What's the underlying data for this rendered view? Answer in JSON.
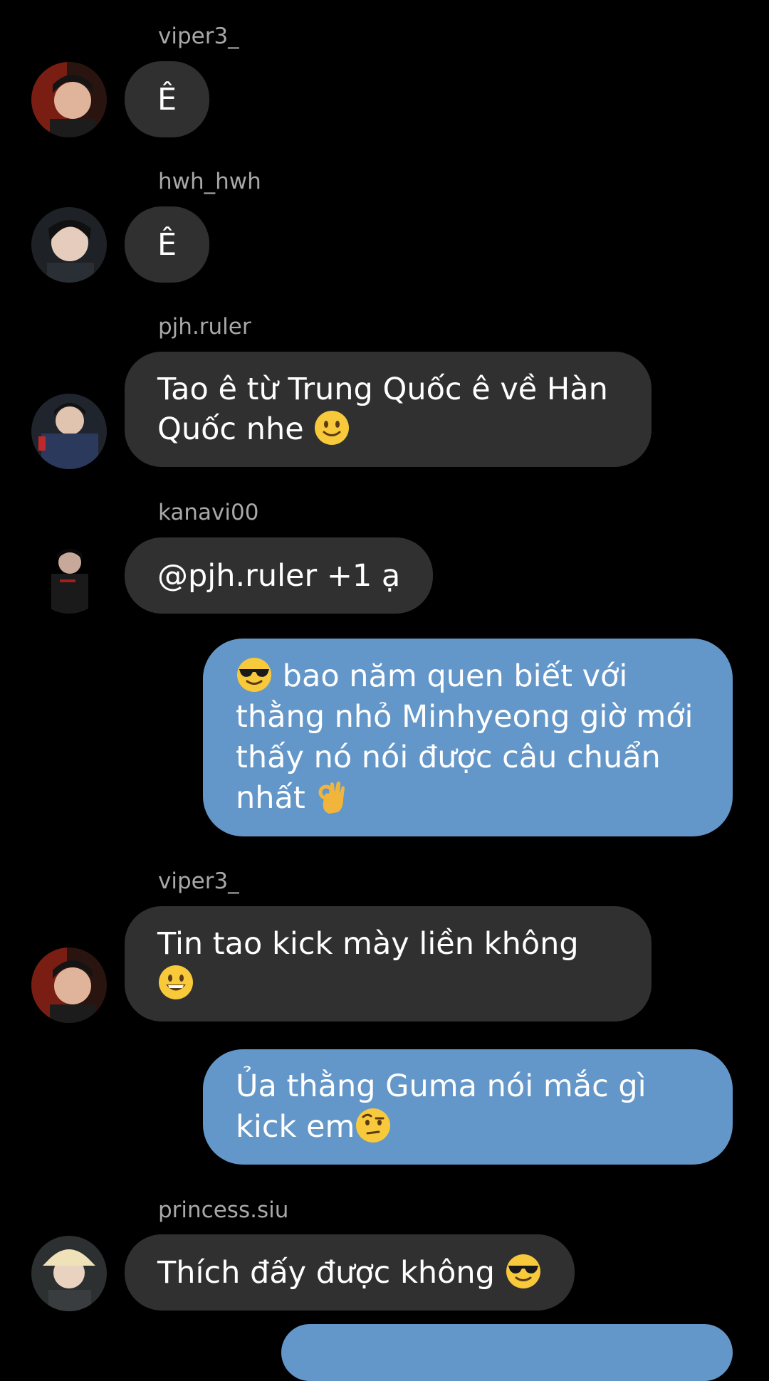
{
  "chat": {
    "messages": [
      {
        "sender": "viper3_",
        "text": "Ê"
      },
      {
        "sender": "hwh_hwh",
        "text": "Ê"
      },
      {
        "sender": "pjh.ruler",
        "text": "Tao ê từ Trung Quốc ê về Hàn\nQuốc nhe",
        "emoji": "slightly-smiling-face"
      },
      {
        "sender": "kanavi00",
        "text": "@pjh.ruler +1 ạ"
      },
      {
        "sender": "",
        "text": "bao năm quen biết với\nthằng nhỏ Minhyeong giờ mới\nthấy nó nói được câu chuẩn\nnhất",
        "emoji_start": "smiling-face-with-sunglasses",
        "emoji": "ok-hand"
      },
      {
        "sender": "viper3_",
        "text": "Tin tao kick mày liền không\n",
        "emoji": "grinning-face"
      },
      {
        "sender": "",
        "text": "Ủa thằng Guma nói mắc gì\nkick em",
        "emoji": "face-with-raised-eyebrow"
      },
      {
        "sender": "princess.siu",
        "text": "Thích đấy được không",
        "emoji": "smiling-face-with-sunglasses"
      }
    ]
  },
  "colors": {
    "background": "#000000",
    "incoming_bubble": "#303030",
    "outgoing_bubble": "#6497c9",
    "sender_name": "#a8a8a8",
    "text": "#ffffff"
  }
}
